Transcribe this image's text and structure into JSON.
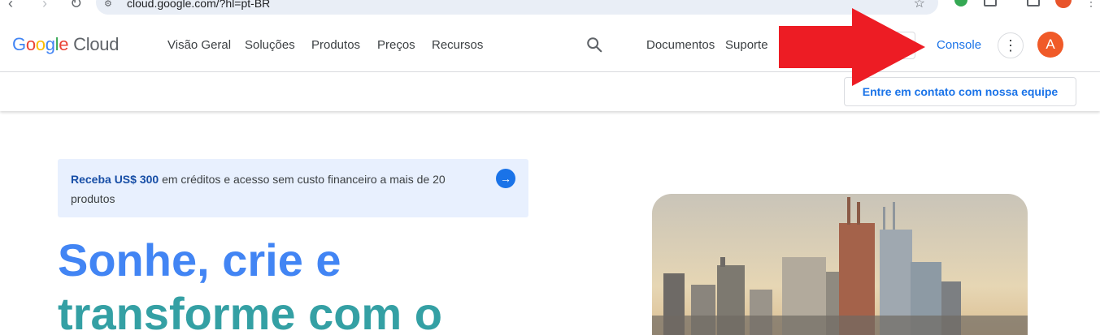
{
  "browser": {
    "url": "cloud.google.com/?hl=pt-BR",
    "nav_back": "‹",
    "nav_forward": "›",
    "nav_reload": "↻",
    "star_icon": "☆",
    "menu_icon": "⋮"
  },
  "header": {
    "logo_google": [
      "G",
      "o",
      "o",
      "g",
      "l",
      "e"
    ],
    "logo_cloud": "Cloud",
    "nav": [
      "Visão Geral",
      "Soluções",
      "Produtos",
      "Preços",
      "Recursos"
    ],
    "docs_label": "Documentos",
    "support_label": "Suporte",
    "console_label": "Console",
    "more_icon": "⋮",
    "avatar_letter": "A"
  },
  "subheader": {
    "contact_label": "Entre em contato com nossa equipe"
  },
  "promo": {
    "strong": "Receba US$ 300",
    "rest": " em créditos e acesso sem custo financeiro a mais de 20 produtos",
    "arrow_icon": "→"
  },
  "hero": {
    "line1": "Sonhe, crie e",
    "line2": "transforme com o"
  },
  "colors": {
    "accent": "#1a73e8",
    "hero_blue": "#4285f4",
    "hero_teal": "#34a0a4",
    "avatar": "#f05a28",
    "annotation_arrow": "#ed1c24"
  },
  "icons": {
    "search": "search-icon",
    "annotation": "red-arrow-icon"
  }
}
